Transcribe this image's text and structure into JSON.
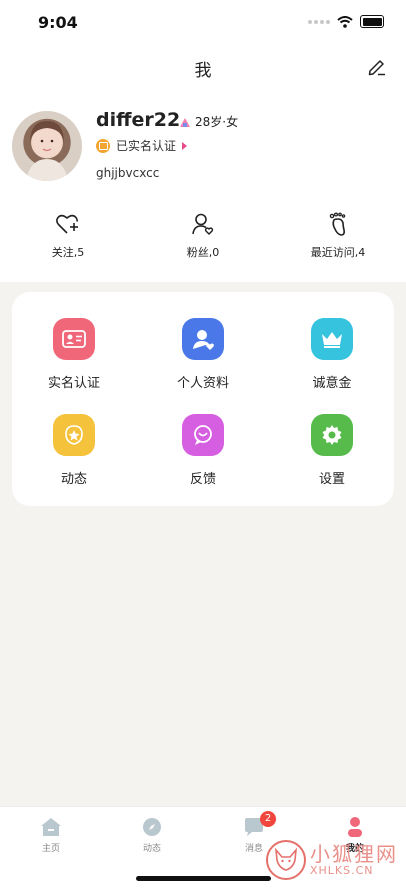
{
  "status_bar": {
    "time": "9:04"
  },
  "header": {
    "title": "我",
    "edit_icon": "edit-pencil-icon"
  },
  "profile": {
    "username": "differ22",
    "age_gender": "28岁·女",
    "verify_text": "已实名认证",
    "user_id": "ghjjbvcxcc"
  },
  "stats": [
    {
      "label": "关注,5",
      "icon": "heart-plus-icon"
    },
    {
      "label": "粉丝,0",
      "icon": "person-heart-icon"
    },
    {
      "label": "最近访问,4",
      "icon": "footprint-icon"
    }
  ],
  "menu": [
    {
      "label": "实名认证",
      "icon": "id-card-icon",
      "color": "#f0677a"
    },
    {
      "label": "个人资料",
      "icon": "profile-icon",
      "color": "#4a78e8"
    },
    {
      "label": "诚意金",
      "icon": "crown-icon",
      "color": "#35c3dd"
    },
    {
      "label": "动态",
      "icon": "star-moment-icon",
      "color": "#f5c23c"
    },
    {
      "label": "反馈",
      "icon": "chat-feedback-icon",
      "color": "#d65ee0"
    },
    {
      "label": "设置",
      "icon": "gear-icon",
      "color": "#56bb4a"
    }
  ],
  "tabbar": [
    {
      "label": "主页",
      "icon": "home-icon"
    },
    {
      "label": "动态",
      "icon": "compass-icon"
    },
    {
      "label": "消息",
      "icon": "message-icon",
      "badge": "2"
    },
    {
      "label": "我的",
      "icon": "me-icon",
      "active": true
    }
  ],
  "watermark": {
    "cn": "小狐狸网",
    "en": "XHLKS.CN"
  }
}
